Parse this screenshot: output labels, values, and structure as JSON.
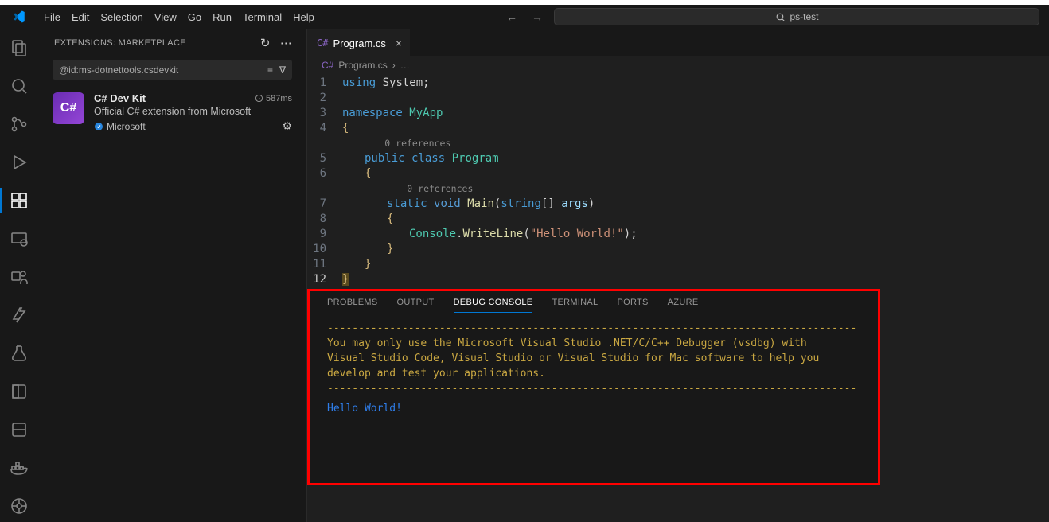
{
  "menu": {
    "file": "File",
    "edit": "Edit",
    "selection": "Selection",
    "view": "View",
    "go": "Go",
    "run": "Run",
    "terminal": "Terminal",
    "help": "Help"
  },
  "search": {
    "icon": "search",
    "text": "ps-test"
  },
  "sidebar": {
    "header": "EXTENSIONS: MARKETPLACE",
    "search_value": "@id:ms-dotnettools.csdevkit",
    "ext": {
      "icon_text": "C#",
      "title": "C# Dev Kit",
      "time": "587ms",
      "desc": "Official C# extension from Microsoft",
      "publisher": "Microsoft"
    }
  },
  "tab": {
    "file": "Program.cs"
  },
  "breadcrumb": {
    "file": "Program.cs",
    "sep": "›",
    "more": "…"
  },
  "code": {
    "l1": {
      "n": "1",
      "kw": "using",
      "ns": " System",
      "p": ";"
    },
    "l2": {
      "n": "2"
    },
    "l3": {
      "n": "3",
      "kw": "namespace",
      "cls": " MyApp"
    },
    "l4": {
      "n": "4",
      "br": "{"
    },
    "ref1": "0 references",
    "l5": {
      "n": "5",
      "kw": "public class",
      "cls": " Program"
    },
    "l6": {
      "n": "6",
      "br": "{"
    },
    "ref2": "0 references",
    "l7": {
      "n": "7",
      "kw1": "static ",
      "kw2": "void ",
      "fn": "Main",
      "p1": "(",
      "ty": "string",
      "arr": "[] ",
      "arg": "args",
      "p2": ")"
    },
    "l8": {
      "n": "8",
      "br": "{"
    },
    "l9": {
      "n": "9",
      "obj": "Console",
      "dot": ".",
      "fn": "WriteLine",
      "p1": "(",
      "str": "\"Hello World!\"",
      "p2": ");"
    },
    "l10": {
      "n": "10",
      "br": "}"
    },
    "l11": {
      "n": "11",
      "br": "}"
    },
    "l12": {
      "n": "12",
      "br": "}"
    }
  },
  "panel": {
    "tabs": {
      "problems": "PROBLEMS",
      "output": "OUTPUT",
      "debug": "DEBUG CONSOLE",
      "terminal": "TERMINAL",
      "ports": "PORTS",
      "azure": "AZURE"
    },
    "dash": "-------------------------------------------------------------------------------------",
    "notice1": "You may only use the Microsoft Visual Studio .NET/C/C++ Debugger (vsdbg) with",
    "notice2": "Visual Studio Code, Visual Studio or Visual Studio for Mac software to help you",
    "notice3": "develop and test your applications.",
    "output": "Hello World!"
  }
}
